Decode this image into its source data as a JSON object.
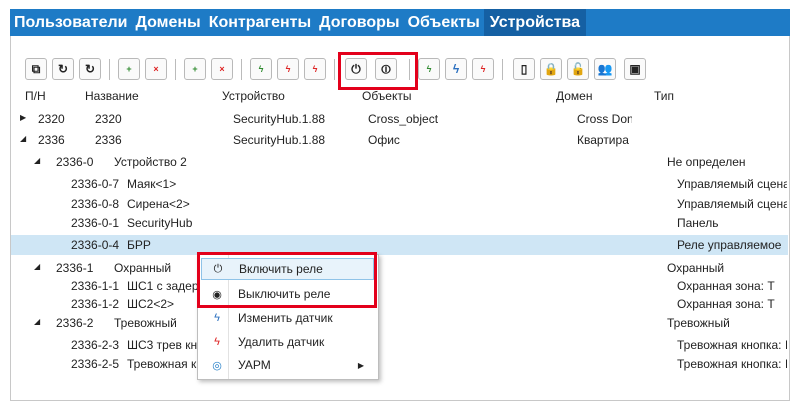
{
  "nav": {
    "tabs": [
      {
        "label": "Пользователи"
      },
      {
        "label": "Домены"
      },
      {
        "label": "Контрагенты"
      },
      {
        "label": "Договоры"
      },
      {
        "label": "Объекты"
      },
      {
        "label": "Устройства"
      }
    ],
    "active": "Устройства"
  },
  "toolbar": {
    "buttons": [
      {
        "icon": "tree-icon",
        "glyph": "⧉"
      },
      {
        "icon": "refresh-icon",
        "glyph": "↻"
      },
      {
        "icon": "refresh-check-icon",
        "glyph": "↻"
      },
      {
        "icon": "add-node-icon",
        "glyph": "+"
      },
      {
        "icon": "remove-node-icon",
        "glyph": "×"
      },
      {
        "icon": "add-device-icon",
        "glyph": "+"
      },
      {
        "icon": "remove-device-icon",
        "glyph": "×"
      },
      {
        "icon": "add-sensor-icon",
        "glyph": "ϟ"
      },
      {
        "icon": "edit-sensor-icon",
        "glyph": "ϟ"
      },
      {
        "icon": "delete-sensor-icon",
        "glyph": "ϟ"
      },
      {
        "icon": "power-on-icon",
        "glyph": "⏻"
      },
      {
        "icon": "power-off-icon",
        "glyph": "⏼"
      },
      {
        "icon": "add-zone-icon",
        "glyph": "ϟ"
      },
      {
        "icon": "edit-zone-icon",
        "glyph": "ϟ"
      },
      {
        "icon": "delete-zone-icon",
        "glyph": "ϟ"
      },
      {
        "icon": "phone-icon",
        "glyph": "▯"
      },
      {
        "icon": "lock-icon",
        "glyph": "🔒"
      },
      {
        "icon": "unlock-icon",
        "glyph": "🔓"
      },
      {
        "icon": "users-icon",
        "glyph": "👥"
      },
      {
        "icon": "panel-icon",
        "glyph": "▣"
      }
    ]
  },
  "columns": {
    "pn": "П/Н",
    "name": "Название",
    "device": "Устройство",
    "objects": "Объекты",
    "domain": "Домен",
    "type": "Тип"
  },
  "rows": [
    {
      "arrow": "▶",
      "pn": "2320",
      "name": "2320",
      "device": "SecurityHub.1.88",
      "objects": "Cross_object",
      "domain": "Cross Don",
      "type": ""
    },
    {
      "arrow": "◢",
      "pn": "2336",
      "name": "2336",
      "device": "SecurityHub.1.88",
      "objects": "Офис",
      "domain": "Квартира",
      "type": ""
    },
    {
      "arrow": "◢",
      "pn": "2336-0",
      "name": "Устройство 2",
      "device": "",
      "objects": "",
      "domain": "",
      "type": "Не определен"
    },
    {
      "arrow": "",
      "pn": "2336-0-7",
      "name": "Маяк<1>",
      "device": "",
      "objects": "",
      "domain": "",
      "type": "Управляемый сцена"
    },
    {
      "arrow": "",
      "pn": "2336-0-8",
      "name": "Сирена<2>",
      "device": "",
      "objects": "",
      "domain": "",
      "type": "Управляемый сцена"
    },
    {
      "arrow": "",
      "pn": "2336-0-1",
      "name": "SecurityHub",
      "device": "",
      "objects": "",
      "domain": "",
      "type": "Панель"
    },
    {
      "arrow": "",
      "pn": "2336-0-4",
      "name": "БРР",
      "device": "",
      "objects": "",
      "domain": "",
      "type": "Реле управляемое"
    },
    {
      "arrow": "◢",
      "pn": "2336-1",
      "name": "Охранный",
      "device": "",
      "objects": "",
      "domain": "",
      "type": "Охранный"
    },
    {
      "arrow": "",
      "pn": "2336-1-1",
      "name": "ШС1 с задер",
      "device": "",
      "objects": "",
      "domain": "",
      "type": "Охранная зона: Т"
    },
    {
      "arrow": "",
      "pn": "2336-1-2",
      "name": "ШС2<2>",
      "device": "",
      "objects": "",
      "domain": "",
      "type": "Охранная зона: Т"
    },
    {
      "arrow": "◢",
      "pn": "2336-2",
      "name": "Тревожный",
      "device": "",
      "objects": "",
      "domain": "",
      "type": "Тревожный"
    },
    {
      "arrow": "",
      "pn": "2336-2-3",
      "name": "ШС3 трев кн",
      "device": "",
      "objects": "",
      "domain": "",
      "type": "Тревожная кнопка: I"
    },
    {
      "arrow": "",
      "pn": "2336-2-5",
      "name": "Тревожная к",
      "device": "",
      "objects": "",
      "domain": "",
      "type": "Тревожная кнопка: I"
    }
  ],
  "context_menu": {
    "items": [
      {
        "label": "Включить реле",
        "icon": "power-on-icon",
        "glyph": "⏻"
      },
      {
        "label": "Выключить реле",
        "icon": "power-off-icon",
        "glyph": "◉"
      },
      {
        "label": "Изменить датчик",
        "icon": "edit-sensor-icon",
        "glyph": "ϟ"
      },
      {
        "label": "Удалить датчик",
        "icon": "delete-sensor-icon",
        "glyph": "ϟ"
      },
      {
        "label": "УАРМ",
        "icon": "uarm-icon",
        "glyph": "◎"
      }
    ]
  },
  "colors": {
    "nav_bg": "#1e7bc6",
    "nav_active": "#1560a3",
    "highlight": "#e3001b",
    "selected_row": "#cfe6f5"
  }
}
